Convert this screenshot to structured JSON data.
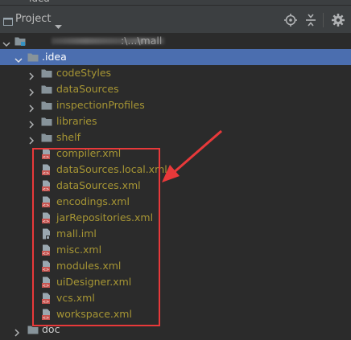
{
  "window": {
    "top_fragment": "idea"
  },
  "header": {
    "title": "Project",
    "icons": [
      "project-view-icon",
      "dropdown-caret-icon",
      "locate-target-icon",
      "collapse-all-icon",
      "settings-gear-icon"
    ]
  },
  "tree": {
    "root_path": ":\\...\\mall",
    "idea_folder": ".idea",
    "idea_subfolders": [
      {
        "label": "codeStyles"
      },
      {
        "label": "dataSources"
      },
      {
        "label": "inspectionProfiles"
      },
      {
        "label": "libraries"
      },
      {
        "label": "shelf"
      }
    ],
    "idea_files": [
      {
        "label": "compiler.xml",
        "type": "xml"
      },
      {
        "label": "dataSources.local.xml",
        "type": "xml"
      },
      {
        "label": "dataSources.xml",
        "type": "xml"
      },
      {
        "label": "encodings.xml",
        "type": "xml"
      },
      {
        "label": "jarRepositories.xml",
        "type": "xml"
      },
      {
        "label": "mall.iml",
        "type": "iml"
      },
      {
        "label": "misc.xml",
        "type": "xml"
      },
      {
        "label": "modules.xml",
        "type": "xml"
      },
      {
        "label": "uiDesigner.xml",
        "type": "xml"
      },
      {
        "label": "vcs.xml",
        "type": "xml"
      },
      {
        "label": "workspace.xml",
        "type": "xml"
      }
    ],
    "doc_folder": "doc"
  },
  "colors": {
    "selected_row": "#4b6eaf",
    "ignored_file_text": "#a69534",
    "annotation_red": "#e8393a"
  }
}
